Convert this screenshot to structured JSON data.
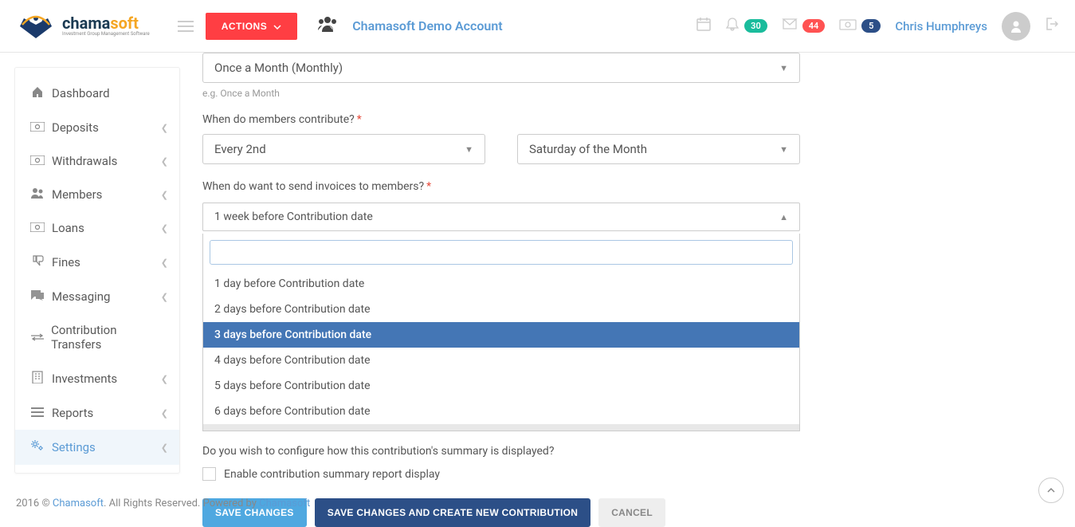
{
  "header": {
    "logo_main_a": "chama",
    "logo_main_b": "soft",
    "logo_sub": "Investment Group Management Software",
    "actions_label": "ACTIONS",
    "account_name": "Chamasoft Demo Account",
    "badge_bell": "30",
    "badge_mail": "44",
    "badge_money": "5",
    "user_name": "Chris Humphreys"
  },
  "sidebar": {
    "items": [
      {
        "label": "Dashboard",
        "icon": "home",
        "chev": false
      },
      {
        "label": "Deposits",
        "icon": "money",
        "chev": true
      },
      {
        "label": "Withdrawals",
        "icon": "money",
        "chev": true
      },
      {
        "label": "Members",
        "icon": "users",
        "chev": true
      },
      {
        "label": "Loans",
        "icon": "money",
        "chev": true
      },
      {
        "label": "Fines",
        "icon": "thumbs-down",
        "chev": true
      },
      {
        "label": "Messaging",
        "icon": "chat",
        "chev": true
      },
      {
        "label": "Contribution Transfers",
        "icon": "transfer",
        "chev": false
      },
      {
        "label": "Investments",
        "icon": "building",
        "chev": true
      },
      {
        "label": "Reports",
        "icon": "bars",
        "chev": true
      },
      {
        "label": "Settings",
        "icon": "gears",
        "chev": true,
        "active": true
      }
    ]
  },
  "form": {
    "frequency_value": "Once a Month (Monthly)",
    "frequency_hint": "e.g. Once a Month",
    "contribute_label": "When do members contribute?",
    "contribute_day_value": "Every 2nd",
    "contribute_weekday_value": "Saturday of the Month",
    "invoice_label": "When do want to send invoices to members?",
    "invoice_value": "1 week before Contribution date",
    "invoice_options": [
      "1 day before Contribution date",
      "2 days before Contribution date",
      "3 days before Contribution date",
      "4 days before Contribution date",
      "5 days before Contribution date",
      "6 days before Contribution date",
      "1 week before Contribution date"
    ],
    "invoice_highlight_index": 2,
    "summary_question": "Do you wish to configure how this contribution's summary is displayed?",
    "summary_checkbox_label": "Enable contribution summary report display",
    "btn_save": "SAVE CHANGES",
    "btn_save_new": "SAVE CHANGES AND CREATE NEW CONTRIBUTION",
    "btn_cancel": "CANCEL"
  },
  "footer": {
    "year": "2016 ©",
    "brand": "Chamasoft",
    "rights": ". All Rights Reserved. Powered by",
    "powered": "Chamasoft"
  }
}
